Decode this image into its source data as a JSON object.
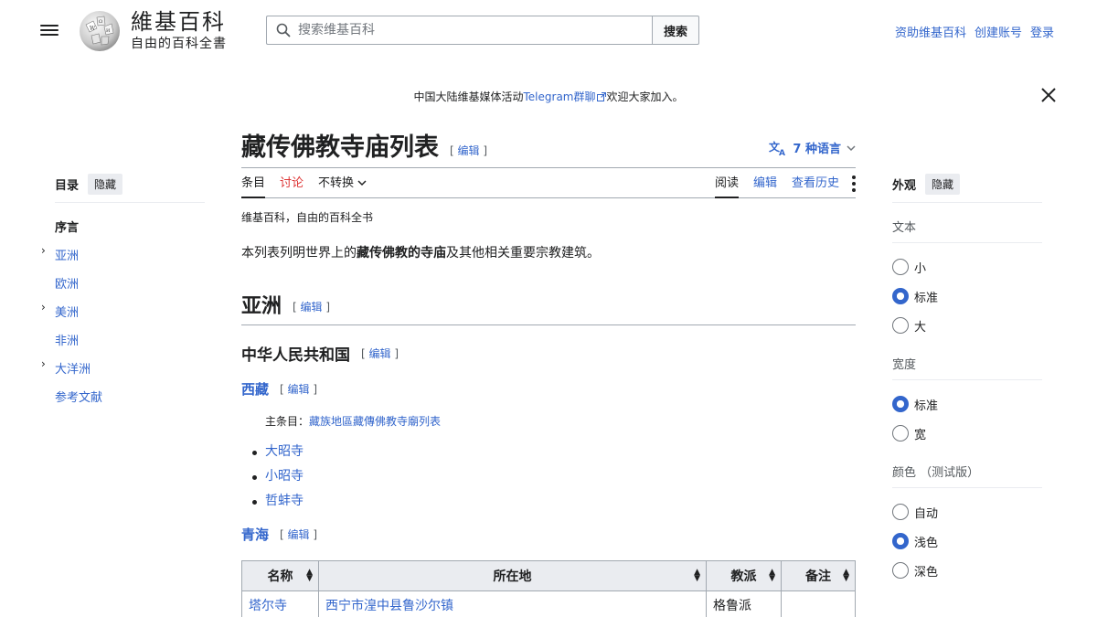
{
  "header": {
    "logo_title": "維基百科",
    "logo_tagline": "自由的百科全書",
    "search_placeholder": "搜索维基百科",
    "search_button": "搜索",
    "user_links": [
      "资助维基百科",
      "创建账号",
      "登录"
    ]
  },
  "banner": {
    "prefix": "中国大陆维基媒体活动",
    "link": "Telegram群聊",
    "suffix": "欢迎大家加入。"
  },
  "toc": {
    "title": "目录",
    "hide": "隐藏",
    "items": [
      {
        "label": "序言",
        "expandable": false
      },
      {
        "label": "亚洲",
        "expandable": true
      },
      {
        "label": "欧洲",
        "expandable": false
      },
      {
        "label": "美洲",
        "expandable": true
      },
      {
        "label": "非洲",
        "expandable": false
      },
      {
        "label": "大洋洲",
        "expandable": true
      },
      {
        "label": "参考文献",
        "expandable": false
      }
    ]
  },
  "article": {
    "title": "藏传佛教寺庙列表",
    "edit_label": "编辑",
    "languages": "7 种语言",
    "tabs": {
      "article": "条目",
      "talk": "讨论",
      "variant": "不转换",
      "read": "阅读",
      "edit": "编辑",
      "history": "查看历史"
    },
    "tagline": "维基百科，自由的百科全书",
    "intro": {
      "pre": "本列表列明世界上的",
      "link": "藏传佛教",
      "bold": "的寺庙",
      "post": "及其他相关重要宗教建筑。"
    },
    "section_asia": "亚洲",
    "section_prc": "中华人民共和国",
    "section_tibet": "西藏",
    "main_article_label": "主条目：",
    "main_article_link": "藏族地區藏傳佛教寺廟列表",
    "tibet_list": [
      "大昭寺",
      "小昭寺",
      "哲蚌寺"
    ],
    "section_qinghai": "青海",
    "table": {
      "headers": [
        "名称",
        "所在地",
        "教派",
        "备注"
      ],
      "rows": [
        {
          "name": "塔尔寺",
          "location": "西宁市湟中县鲁沙尔镇",
          "school": "格鲁派",
          "note": ""
        }
      ]
    }
  },
  "appearance": {
    "title": "外观",
    "hide": "隐藏",
    "text_label": "文本",
    "text_options": [
      {
        "label": "小",
        "selected": false
      },
      {
        "label": "标准",
        "selected": true
      },
      {
        "label": "大",
        "selected": false
      }
    ],
    "width_label": "宽度",
    "width_options": [
      {
        "label": "标准",
        "selected": true
      },
      {
        "label": "宽",
        "selected": false
      }
    ],
    "color_label": "颜色 （测试版）",
    "color_options": [
      {
        "label": "自动",
        "selected": false
      },
      {
        "label": "浅色",
        "selected": true
      },
      {
        "label": "深色",
        "selected": false
      }
    ]
  },
  "colors": {
    "link": "#3366cc",
    "talk": "#dd3333",
    "text": "#202122",
    "border": "#a2a9b1"
  }
}
